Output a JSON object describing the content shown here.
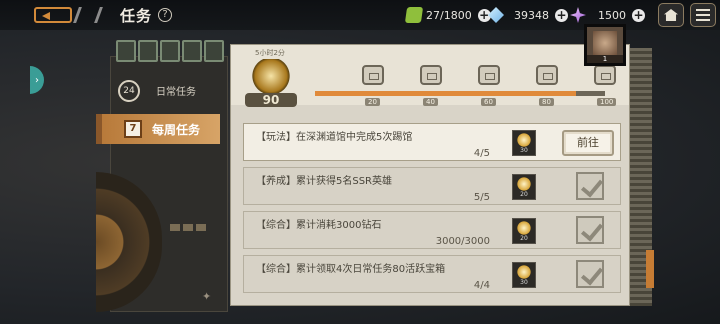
{
  "header": {
    "title": "任务",
    "help": "?"
  },
  "resources": {
    "stamina": "27/1800",
    "crystal": "39348",
    "gem": "1500"
  },
  "sidebar": {
    "daily_badge": "24",
    "daily_label": "日常任务",
    "weekly_badge": "7",
    "weekly_label": "每周任务"
  },
  "weekly_progress": {
    "timer": "5小时2分",
    "points": "90",
    "progress_fraction": 0.9,
    "milestones": [
      "20",
      "40",
      "60",
      "80",
      "100"
    ]
  },
  "corner_item": {
    "count": "1"
  },
  "tasks": [
    {
      "text": "【玩法】在深渊道馆中完成5次踢馆",
      "count": "4/5",
      "reward": "30",
      "button": "前往",
      "done": false
    },
    {
      "text": "【养成】累计获得5名SSR英雄",
      "count": "5/5",
      "reward": "20",
      "done": true
    },
    {
      "text": "【综合】累计消耗3000钻石",
      "count": "3000/3000",
      "reward": "20",
      "done": true
    },
    {
      "text": "【综合】累计领取4次日常任务80活跃宝箱",
      "count": "4/4",
      "reward": "30",
      "done": true
    }
  ],
  "colors": {
    "accent": "#d7a467",
    "progress": "#e08a3a",
    "panel": "#d9d4c8"
  }
}
